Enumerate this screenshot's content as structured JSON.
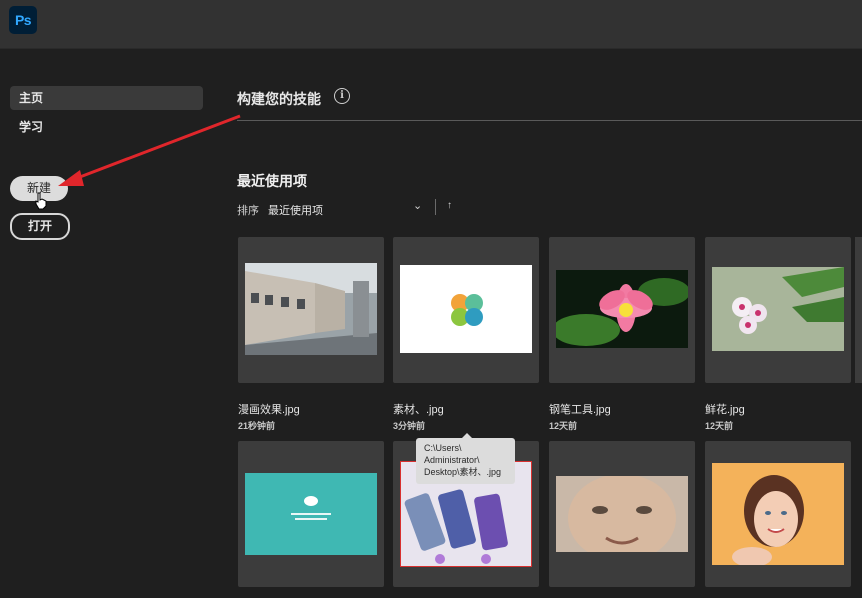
{
  "app": {
    "logo_text": "Ps"
  },
  "sidebar": {
    "items": [
      {
        "label": "主页",
        "active": true
      },
      {
        "label": "学习",
        "active": false
      }
    ],
    "new_button": "新建",
    "open_button": "打开"
  },
  "main": {
    "skills_title": "构建您的技能",
    "info_icon_glyph": "i",
    "recent_title": "最近使用项",
    "sort_label": "排序",
    "sort_value": "最近使用项",
    "sort_chevron": "⌄",
    "sort_direction_glyph": "↑",
    "files": [
      {
        "name": "漫画效果.jpg",
        "date": "21秒钟前"
      },
      {
        "name": "素材、.jpg",
        "date": "3分钟前"
      },
      {
        "name": "钢笔工具.jpg",
        "date": "12天前"
      },
      {
        "name": "鲜花.jpg",
        "date": "12天前"
      },
      {
        "name": "",
        "date": ""
      },
      {
        "name": "",
        "date": ""
      },
      {
        "name": "",
        "date": ""
      },
      {
        "name": "",
        "date": ""
      }
    ],
    "tooltip": {
      "line1": "C:\\Users\\",
      "line2": "Administrator\\",
      "line3": "Desktop\\素材、.jpg"
    }
  },
  "colors": {
    "background": "#1f1f1f",
    "topbar": "#323232",
    "card": "#3c3c3c",
    "arrow": "#e0262b",
    "ps_blue": "#31a8ff"
  },
  "icons": {
    "logo": "photoshop-logo",
    "info": "info-icon",
    "chevron": "chevron-down-icon",
    "sort": "sort-up-arrow-icon",
    "cursor": "hand-pointer-icon",
    "annotation": "red-arrow-annotation"
  }
}
